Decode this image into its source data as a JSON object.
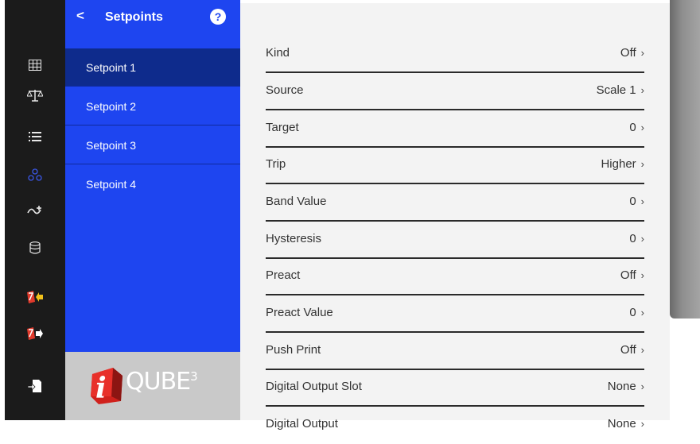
{
  "rail": {
    "icons": [
      "grid-icon",
      "scale-icon",
      "list-icon",
      "network-icon",
      "signal-icon",
      "database-icon",
      "import-icon",
      "export-icon",
      "file-transfer-icon"
    ],
    "active": "network-icon",
    "active_color": "#3a57e8"
  },
  "menu": {
    "back_glyph": "<",
    "title": "Setpoints",
    "help_glyph": "?",
    "items": [
      {
        "label": "Setpoint 1"
      },
      {
        "label": "Setpoint 2"
      },
      {
        "label": "Setpoint 3"
      },
      {
        "label": "Setpoint 4"
      }
    ],
    "selected_index": 0,
    "bg_color": "#1e45f0",
    "selected_color": "#0e2b8c",
    "logo_text": "QUBE",
    "logo_superscript": "3",
    "logo_prefix_glyph": "i"
  },
  "settings": [
    {
      "label": "Kind",
      "value": "Off"
    },
    {
      "label": "Source",
      "value": "Scale 1"
    },
    {
      "label": "Target",
      "value": "0"
    },
    {
      "label": "Trip",
      "value": "Higher"
    },
    {
      "label": "Band Value",
      "value": "0"
    },
    {
      "label": "Hysteresis",
      "value": "0"
    },
    {
      "label": "Preact",
      "value": "Off"
    },
    {
      "label": "Preact Value",
      "value": "0"
    },
    {
      "label": "Push Print",
      "value": "Off"
    },
    {
      "label": "Digital Output Slot",
      "value": "None"
    },
    {
      "label": "Digital Output",
      "value": "None"
    }
  ],
  "chevron_glyph": "›"
}
